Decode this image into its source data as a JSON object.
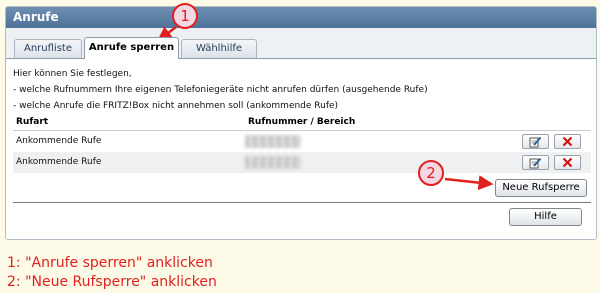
{
  "panel": {
    "title": "Anrufe"
  },
  "tabs": [
    {
      "label": "Anrufliste",
      "active": false
    },
    {
      "label": "Anrufe sperren",
      "active": true
    },
    {
      "label": "Wählhilfe",
      "active": false
    }
  ],
  "intro": [
    "Hier können Sie festlegen,",
    "- welche Rufnummern Ihre eigenen Telefoniegeräte nicht anrufen dürfen (ausgehende Rufe)",
    "- welche Anrufe die FRITZ!Box nicht annehmen soll (ankommende Rufe)"
  ],
  "table": {
    "headers": {
      "rufart": "Rufart",
      "rufnummer": "Rufnummer / Bereich"
    },
    "rows": [
      {
        "rufart": "Ankommende Rufe"
      },
      {
        "rufart": "Ankommende Rufe"
      }
    ]
  },
  "buttons": {
    "neue_rufsperre": "Neue Rufsperre",
    "hilfe": "Hilfe"
  },
  "badges": {
    "one": "1",
    "two": "2"
  },
  "notes": [
    "1: \"Anrufe sperren\" anklicken",
    "2: \"Neue Rufsperre\" anklicken"
  ],
  "colors": {
    "annotation": "#e02020",
    "header": "#5b7ca3",
    "delete": "#d01010"
  },
  "icons": {
    "edit": "edit-icon",
    "delete": "delete-icon"
  }
}
